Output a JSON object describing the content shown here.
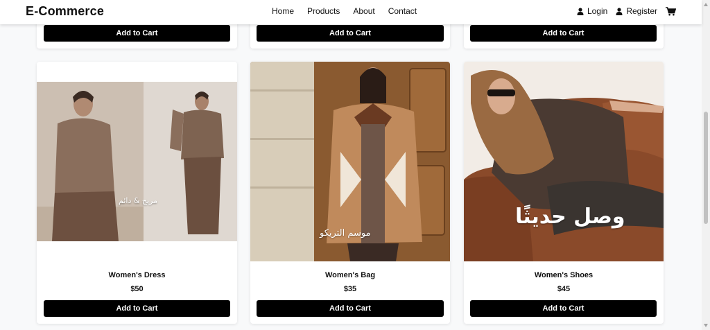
{
  "navbar": {
    "brand": "E-Commerce",
    "links": [
      "Home",
      "Products",
      "About",
      "Contact"
    ],
    "login": "Login",
    "register": "Register"
  },
  "top_row": {
    "button_label": "Add to Cart"
  },
  "products": [
    {
      "title": "Women's Dress",
      "price": "$50",
      "button": "Add to Cart",
      "overlay": "مريح & دائم"
    },
    {
      "title": "Women's Bag",
      "price": "$35",
      "button": "Add to Cart",
      "overlay": "موسم التريكو"
    },
    {
      "title": "Women's Shoes",
      "price": "$45",
      "button": "Add to Cart",
      "overlay": "وصل حديثًا"
    }
  ],
  "colors": {
    "button": "#000000",
    "card": "#ffffff",
    "background": "#f8f9fa"
  },
  "icons": [
    "user-icon",
    "cart-icon"
  ]
}
